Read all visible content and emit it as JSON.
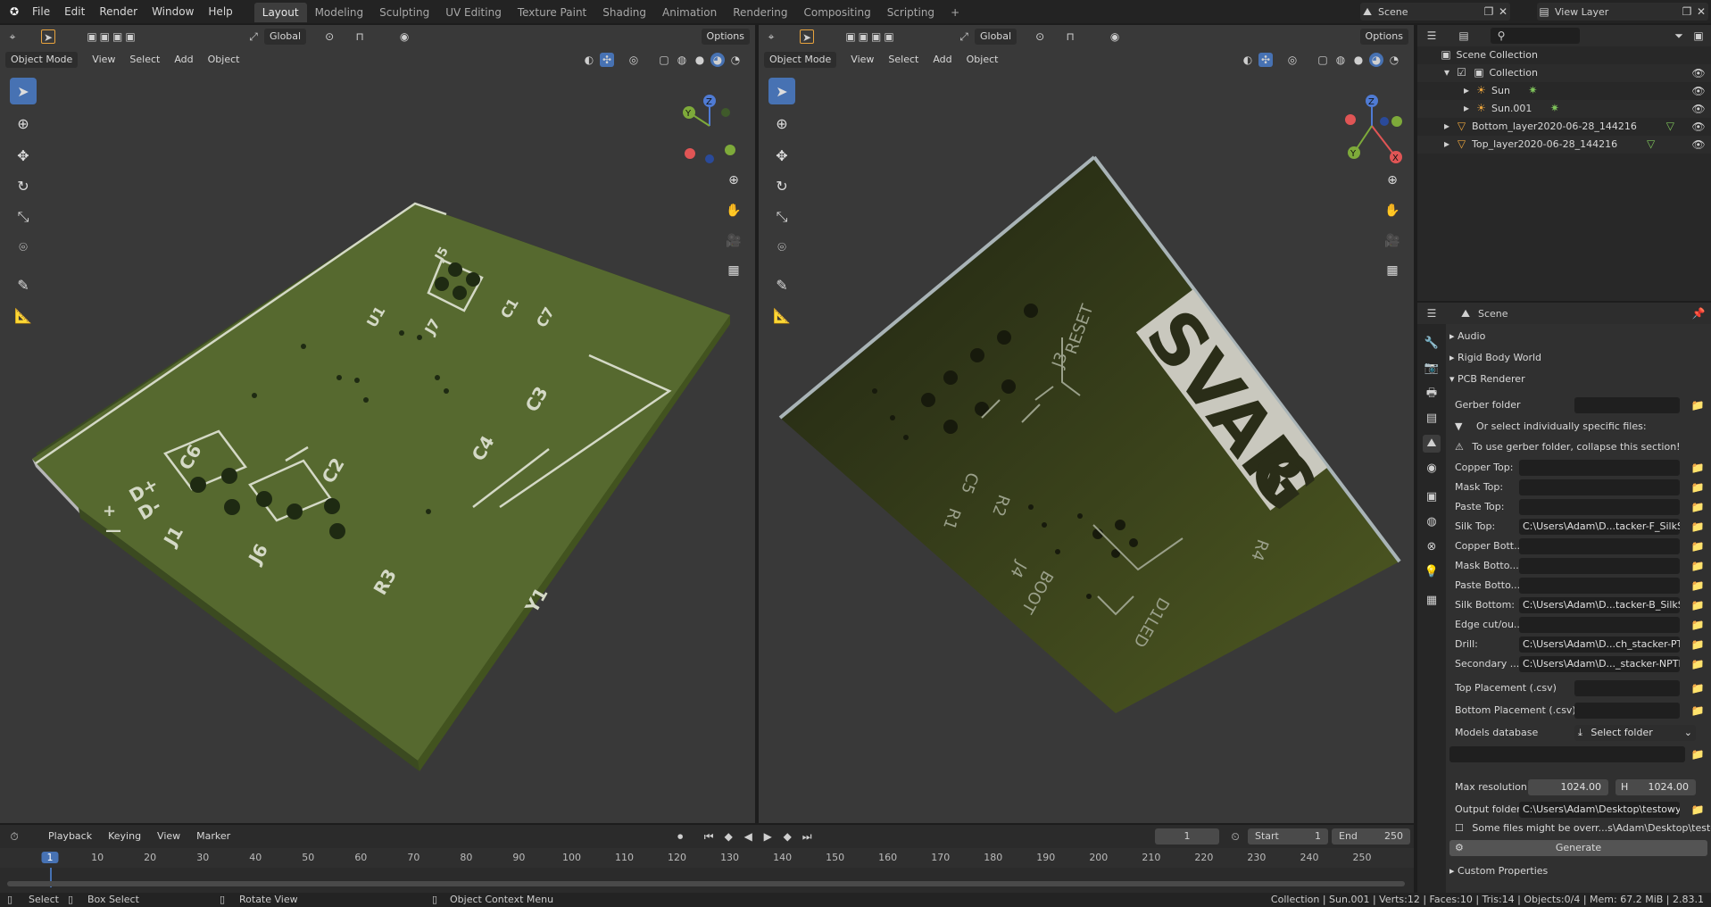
{
  "topbar": {
    "menus": [
      "File",
      "Edit",
      "Render",
      "Window",
      "Help"
    ],
    "workspaces": [
      "Layout",
      "Modeling",
      "Sculpting",
      "UV Editing",
      "Texture Paint",
      "Shading",
      "Animation",
      "Rendering",
      "Compositing",
      "Scripting"
    ],
    "active_workspace": "Layout",
    "add_workspace": "+",
    "scene_label": "Scene",
    "view_layer_label": "View Layer"
  },
  "viewport_left": {
    "orientation": "Global",
    "options": "Options",
    "mode": "Object Mode",
    "menu": [
      "View",
      "Select",
      "Add",
      "Object"
    ],
    "pcb_labels": [
      "J5",
      "U1",
      "J7",
      "C1",
      "C7",
      "C3",
      "C4",
      "C6",
      "C2",
      "D+",
      "D-",
      "J1",
      "J6",
      "R3",
      "Y1",
      "+",
      "—"
    ]
  },
  "viewport_right": {
    "orientation": "Global",
    "options": "Options",
    "mode": "Object Mode",
    "menu": [
      "View",
      "Select",
      "Add",
      "Object"
    ],
    "pcb_labels": [
      "SVAR",
      "G",
      "RESET",
      "J3",
      "C5",
      "R2",
      "R1",
      "R4",
      "BOOT",
      "J4",
      "D1LED"
    ]
  },
  "gizmo": {
    "x": "X",
    "y": "Y",
    "z": "Z"
  },
  "outliner": {
    "search_placeholder": "",
    "items": [
      {
        "label": "Scene Collection",
        "depth": 0
      },
      {
        "label": "Collection",
        "depth": 1
      },
      {
        "label": "Sun",
        "depth": 2
      },
      {
        "label": "Sun.001",
        "depth": 2
      },
      {
        "label": "Bottom_layer2020-06-28_144216",
        "depth": 1
      },
      {
        "label": "Top_layer2020-06-28_144216",
        "depth": 1
      }
    ]
  },
  "properties": {
    "title": "Scene",
    "sections": [
      "Audio",
      "Rigid Body World",
      "PCB Renderer"
    ],
    "gerber_folder_label": "Gerber folder",
    "gerber_folder_value": "",
    "select_individually": "Or select individually specific files:",
    "warning": "To use gerber folder, collapse this section!",
    "files": [
      {
        "label": "Copper Top:",
        "value": ""
      },
      {
        "label": "Mask Top:",
        "value": ""
      },
      {
        "label": "Paste Top:",
        "value": ""
      },
      {
        "label": "Silk Top:",
        "value": "C:\\Users\\Adam\\D...tacker-F_SilkS.gbr"
      },
      {
        "label": "Copper Bott...",
        "value": ""
      },
      {
        "label": "Mask Botto...",
        "value": ""
      },
      {
        "label": "Paste Botto...",
        "value": ""
      },
      {
        "label": "Silk Bottom:",
        "value": "C:\\Users\\Adam\\D...tacker-B_SilkS.gbr"
      },
      {
        "label": "Edge cut/ou...",
        "value": ""
      },
      {
        "label": "Drill:",
        "value": "C:\\Users\\Adam\\D...ch_stacker-PTH.drl"
      },
      {
        "label": "Secondary ...",
        "value": "C:\\Users\\Adam\\D..._stacker-NPTH.drl"
      }
    ],
    "top_placement_label": "Top Placement (.csv)",
    "bottom_placement_label": "Bottom Placement (.csv)",
    "models_db_label": "Models database",
    "models_db_value": "Select folder",
    "max_res_label": "Max resolution:",
    "max_res_w": "1024.00",
    "max_res_h_prefix": "H",
    "max_res_h": "1024.00",
    "output_label": "Output folder:",
    "output_value": "C:\\Users\\Adam\\Desktop\\testowy\\",
    "overwrite_text": "Some files might be overr...s\\Adam\\Desktop\\testowy\\",
    "generate": "Generate",
    "custom_props": "Custom Properties"
  },
  "timeline": {
    "menus": [
      "Playback",
      "Keying",
      "View",
      "Marker"
    ],
    "current_frame": "1",
    "start_label": "Start",
    "start": "1",
    "end_label": "End",
    "end": "250",
    "ticks": [
      "1",
      "10",
      "20",
      "30",
      "40",
      "50",
      "60",
      "70",
      "80",
      "90",
      "100",
      "110",
      "120",
      "130",
      "140",
      "150",
      "160",
      "170",
      "180",
      "190",
      "200",
      "210",
      "220",
      "230",
      "240",
      "250"
    ]
  },
  "status": {
    "select": "Select",
    "box_select": "Box Select",
    "rotate": "Rotate View",
    "context": "Object Context Menu",
    "stats": "Collection | Sun.001 | Verts:12 | Faces:10 | Tris:14 | Objects:0/4 | Mem: 67.2 MiB | 2.83.1"
  }
}
